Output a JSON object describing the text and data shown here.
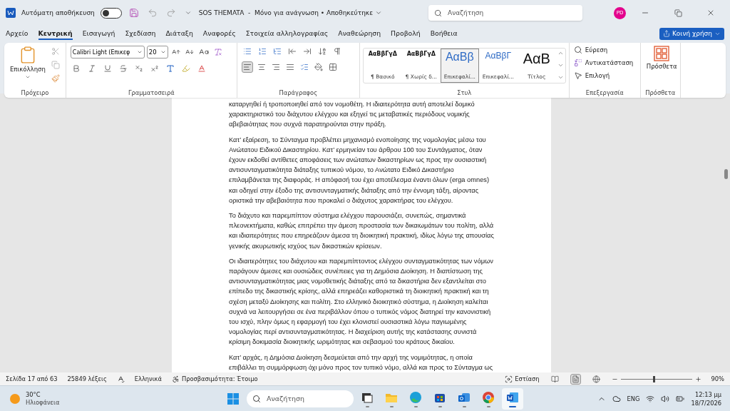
{
  "title_bar": {
    "autosave_label": "Αυτόματη αποθήκευση",
    "autosave_on": false,
    "document_title": "SOS THEMATA  -  Μόνο για ανάγνωση • Αποθηκεύτηκε",
    "search_placeholder": "Αναζήτηση",
    "avatar": "PD"
  },
  "menu_tabs": [
    {
      "label": "Αρχείο",
      "selected": false
    },
    {
      "label": "Κεντρική",
      "selected": true
    },
    {
      "label": "Εισαγωγή",
      "selected": false
    },
    {
      "label": "Σχεδίαση",
      "selected": false
    },
    {
      "label": "Διάταξη",
      "selected": false
    },
    {
      "label": "Αναφορές",
      "selected": false
    },
    {
      "label": "Στοιχεία αλληλογραφίας",
      "selected": false
    },
    {
      "label": "Αναθεώρηση",
      "selected": false
    },
    {
      "label": "Προβολή",
      "selected": false
    },
    {
      "label": "Βοήθεια",
      "selected": false
    }
  ],
  "share_button": "Κοινή χρήση",
  "ribbon": {
    "clipboard": {
      "paste_label": "Επικόλληση",
      "group": "Πρόχειρο"
    },
    "font": {
      "font_name": "Calibri Light (Επικεφ",
      "font_size": "20",
      "group": "Γραμματοσειρά"
    },
    "paragraph": {
      "group": "Παράγραφος",
      "alignments": [
        {
          "selected": true
        },
        {
          "selected": false
        },
        {
          "selected": false
        },
        {
          "selected": false
        }
      ]
    },
    "styles": {
      "group": "Στυλ",
      "items": [
        {
          "preview": "ΑαΒβΓγΔ",
          "name": "¶ Βασικό",
          "kind": "body",
          "selected": false
        },
        {
          "preview": "ΑαΒβΓγΔ",
          "name": "¶ Χωρίς δ...",
          "kind": "body",
          "selected": false
        },
        {
          "preview": "ΑαΒβ",
          "name": "Επικεφαλί...",
          "kind": "heading1",
          "selected": true
        },
        {
          "preview": "ΑαΒβΓ",
          "name": "Επικεφαλί...",
          "kind": "heading2",
          "selected": false
        },
        {
          "preview": "ΑαΒ",
          "name": "Τίτλος",
          "kind": "title",
          "selected": false
        }
      ]
    },
    "editing": {
      "group": "Επεξεργασία",
      "items": [
        {
          "label": "Εύρεση",
          "kind": "find"
        },
        {
          "label": "Αντικατάσταση",
          "kind": "replace"
        },
        {
          "label": "Επιλογή",
          "kind": "select"
        }
      ]
    },
    "addins": {
      "label": "Πρόσθετα",
      "group": "Πρόσθετα"
    }
  },
  "document": {
    "paragraphs": [
      "καταργηθεί ή τροποποιηθεί από τον νομοθέτη. Η ιδιαιτερότητα αυτή αποτελεί δομικό χαρακτηριστικό του διάχυτου ελέγχου και εξηγεί τις μεταβατικές περιόδους νομικής αβεβαιότητας που συχνά παρατηρούνται στην πράξη.",
      "Κατ’ εξαίρεση, το Σύνταγμα προβλέπει μηχανισμό ενοποίησης της νομολογίας μέσω του Ανώτατου Ειδικού Δικαστηρίου.  Κατ’ ερμηνείαν του άρθρου 100 του Συντάγματος, όταν έχουν εκδοθεί αντίθετες αποφάσεις των ανώτατων δικαστηρίων ως προς την ουσιαστική αντισυνταγματικότητα διάταξης τυπικού νόμου, το Ανώτατο Ειδικό Δικαστήριο επιλαμβάνεται της διαφοράς. Η απόφασή του έχει αποτέλεσμα έναντι όλων (erga omnes) και οδηγεί στην έξοδο της αντισυνταγματικής διάταξης από την έννομη τάξη, αίροντας οριστικά την αβεβαιότητα που προκαλεί ο διάχυτος χαρακτήρας του ελέγχου.",
      "Το διάχυτο και παρεμπίπτον σύστημα ελέγχου παρουσιάζει, συνεπώς, σημαντικά πλεονεκτήματα, καθώς επιτρέπει την άμεση προστασία των δικαιωμάτων του πολίτη, αλλά και ιδιαιτερότητες που επηρεάζουν άμεσα τη διοικητική πρακτική, ιδίως λόγω της απουσίας γενικής ακυρωτικής ισχύος των δικαστικών κρίσεων.",
      "Οι ιδιαιτερότητες του διάχυτου και παρεμπίπτοντος ελέγχου συνταγματικότητας των νόμων παράγουν άμεσες και ουσιώδεις συνέπειες για τη Δημόσια Διοίκηση. Η διαπίστωση της αντισυνταγματικότητας μιας νομοθετικής διάταξης από τα δικαστήρια δεν εξαντλείται στο επίπεδο της δικαστικής κρίσης, αλλά επηρεάζει καθοριστικά τη διοικητική πρακτική και τη σχέση μεταξύ Διοίκησης και πολίτη. Στο ελληνικό διοικητικό σύστημα, η Διοίκηση καλείται συχνά να λειτουργήσει σε ένα περιβάλλον όπου ο τυπικός νόμος διατηρεί την κανονιστική του ισχύ, πλην όμως η εφαρμογή του έχει κλονιστεί ουσιαστικά λόγω παγιωμένης νομολογίας περί αντισυνταγματικότητας. Η διαχείριση αυτής της κατάστασης συνιστά κρίσιμη δοκιμασία διοικητικής ωριμότητας και σεβασμού του κράτους δικαίου.",
      "Κατ’ αρχάς, η Δημόσια Διοίκηση δεσμεύεται από την αρχή της νομιμότητας, η οποία επιβάλλει τη συμμόρφωση όχι μόνο προς τον τυπικό νόμο, αλλά και προς το Σύνταγμα ως"
    ]
  },
  "status_bar": {
    "page": "Σελίδα 17 από 63",
    "words": "25849 λέξεις",
    "language": "Ελληνικά",
    "accessibility": "Προσβασιμότητα: Έτοιμο",
    "focus": "Εστίαση",
    "views": [
      {
        "kind": "read",
        "selected": false
      },
      {
        "kind": "print",
        "selected": true
      },
      {
        "kind": "web",
        "selected": false
      }
    ],
    "zoom_slider": {
      "level": 0.45
    },
    "zoom": "90%"
  },
  "taskbar": {
    "temperature": "30°C",
    "weather": "Ηλιοφάνεια",
    "search_placeholder": "Αναζήτηση",
    "apps": [
      {
        "kind": "taskview",
        "active": false
      },
      {
        "kind": "folder",
        "active": false
      },
      {
        "kind": "edge",
        "active": false
      },
      {
        "kind": "store",
        "active": false
      },
      {
        "kind": "outlook",
        "active": false
      },
      {
        "kind": "chrome",
        "active": false
      },
      {
        "kind": "word",
        "active": true
      }
    ],
    "language": "ENG",
    "time": "12:13 μμ",
    "date": "18/7/2026"
  }
}
